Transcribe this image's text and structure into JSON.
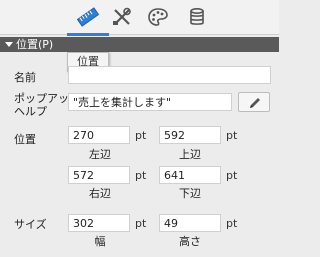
{
  "toolbar": {
    "tabs": [
      {
        "icon": "ruler-icon",
        "active": true
      },
      {
        "icon": "tools-icon",
        "active": false
      },
      {
        "icon": "palette-icon",
        "active": false
      },
      {
        "icon": "database-icon",
        "active": false
      }
    ],
    "accent": "#2f7fd6"
  },
  "section": {
    "title": "位置(P)"
  },
  "tooltip": {
    "text": "位置"
  },
  "fields": {
    "name": {
      "label": "名前",
      "value": ""
    },
    "popup_help": {
      "label_line1": "ポップアップ",
      "label_line2": "ヘルプ",
      "value": "\"売上を集計します\""
    },
    "position": {
      "label": "位置",
      "left": {
        "value": "270",
        "unit": "pt",
        "caption": "左辺"
      },
      "top": {
        "value": "592",
        "unit": "pt",
        "caption": "上辺"
      },
      "right": {
        "value": "572",
        "unit": "pt",
        "caption": "右辺"
      },
      "bottom": {
        "value": "641",
        "unit": "pt",
        "caption": "下辺"
      }
    },
    "size": {
      "label": "サイズ",
      "width": {
        "value": "302",
        "unit": "pt",
        "caption": "幅"
      },
      "height": {
        "value": "49",
        "unit": "pt",
        "caption": "高さ"
      }
    }
  }
}
